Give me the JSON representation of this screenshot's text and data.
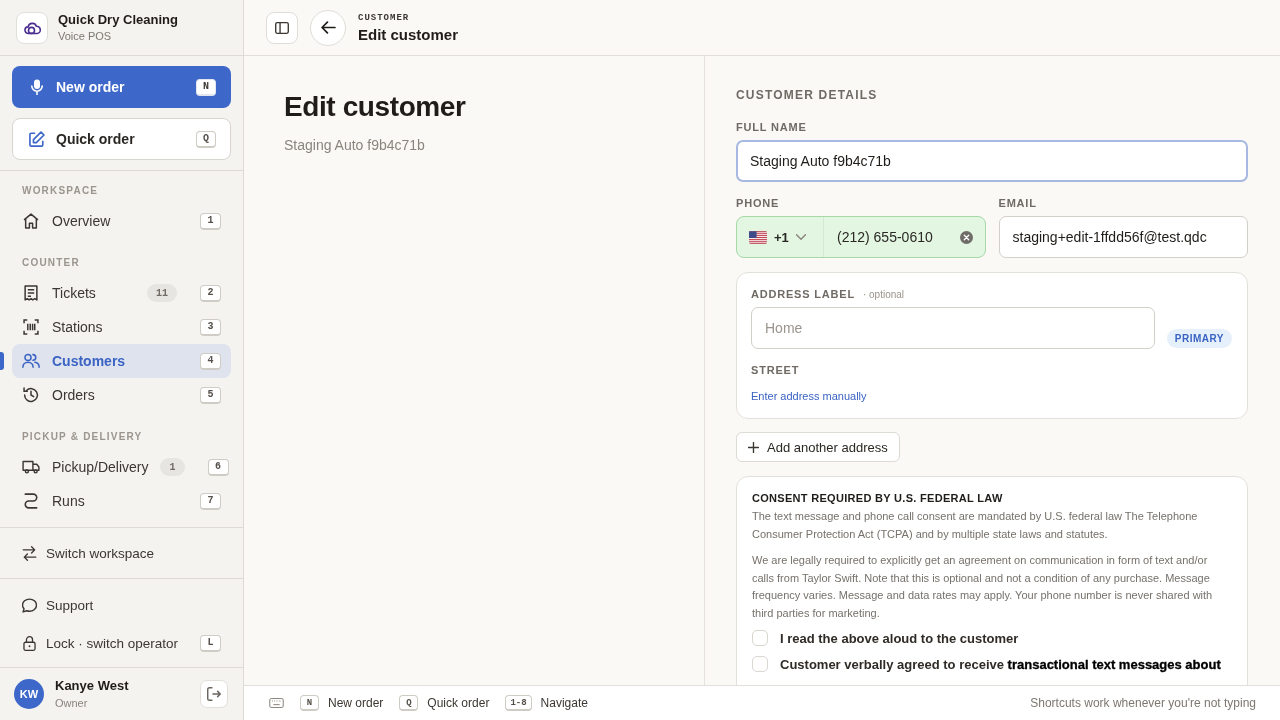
{
  "sidebar": {
    "brand": {
      "name": "Quick Dry Cleaning",
      "subtitle": "Voice POS"
    },
    "actions": [
      {
        "kind": "primary",
        "label": "New order",
        "shortcut": "N"
      },
      {
        "kind": "secondary",
        "label": "Quick order",
        "shortcut": "Q"
      }
    ],
    "sections": [
      {
        "heading": "WORKSPACE",
        "items": [
          {
            "label": "Overview",
            "shortcut": "1",
            "selected": false
          }
        ]
      },
      {
        "heading": "COUNTER",
        "items": [
          {
            "label": "Tickets",
            "count": "11",
            "shortcut": "2",
            "selected": false
          },
          {
            "label": "Stations",
            "shortcut": "3",
            "selected": false
          },
          {
            "label": "Customers",
            "shortcut": "4",
            "selected": true
          },
          {
            "label": "Orders",
            "shortcut": "5",
            "selected": false
          }
        ]
      },
      {
        "heading": "PICKUP & DELIVERY",
        "items": [
          {
            "label": "Pickup/Delivery",
            "count": "1",
            "shortcut": "6",
            "selected": false
          },
          {
            "label": "Runs",
            "shortcut": "7",
            "selected": false
          }
        ]
      }
    ],
    "switch_workspace": {
      "label": "Switch workspace"
    },
    "footer_items": [
      {
        "label": "Support"
      },
      {
        "label": "Lock · switch operator",
        "shortcut": "L"
      }
    ],
    "user": {
      "initials": "KW",
      "name": "Kanye West",
      "role": "Owner"
    }
  },
  "header": {
    "eyebrow": "CUSTOMER",
    "title": "Edit customer"
  },
  "intro": {
    "title": "Edit customer",
    "subtitle": "Staging Auto f9b4c71b"
  },
  "form": {
    "section_title": "CUSTOMER DETAILS",
    "full_name": {
      "label": "FULL NAME",
      "value": "Staging Auto f9b4c71b",
      "focused": true
    },
    "phone": {
      "label": "PHONE",
      "country_code": "+1",
      "value": "(212) 655-0610",
      "valid": true
    },
    "email": {
      "label": "EMAIL",
      "value": "staging+edit-1ffdd56f@test.qdc"
    },
    "address": {
      "label": "ADDRESS LABEL",
      "hint": "· optional",
      "placeholder": "Home",
      "badge": "PRIMARY",
      "street_label": "STREET",
      "manual_link": "Enter address manually"
    },
    "add_address": "Add another address",
    "consent": {
      "title": "CONSENT REQUIRED BY U.S. FEDERAL LAW",
      "paragraphs": [
        "The text message and phone call consent are mandated by U.S. federal law The Telephone Consumer Protection Act (TCPA) and by multiple state laws and statutes.",
        "We are legally required to explicitly get an agreement on communication in form of text and/or calls from Taylor Swift. Note that this is optional and not a condition of any purchase. Message frequency varies. Message and data rates may apply. Your phone number is never shared with third parties for marketing."
      ],
      "checks": [
        {
          "label": "I read the above aloud to the customer",
          "checked": false
        },
        {
          "label": "Customer verbally agreed to receive **transactional text messages about**",
          "checked": false
        }
      ]
    }
  },
  "shortcut_bar": {
    "items": [
      {
        "key": "N",
        "label": "New order"
      },
      {
        "key": "Q",
        "label": "Quick order"
      },
      {
        "key": "1-8",
        "label": "Navigate"
      }
    ],
    "hint": "Shortcuts work whenever you're not typing"
  }
}
